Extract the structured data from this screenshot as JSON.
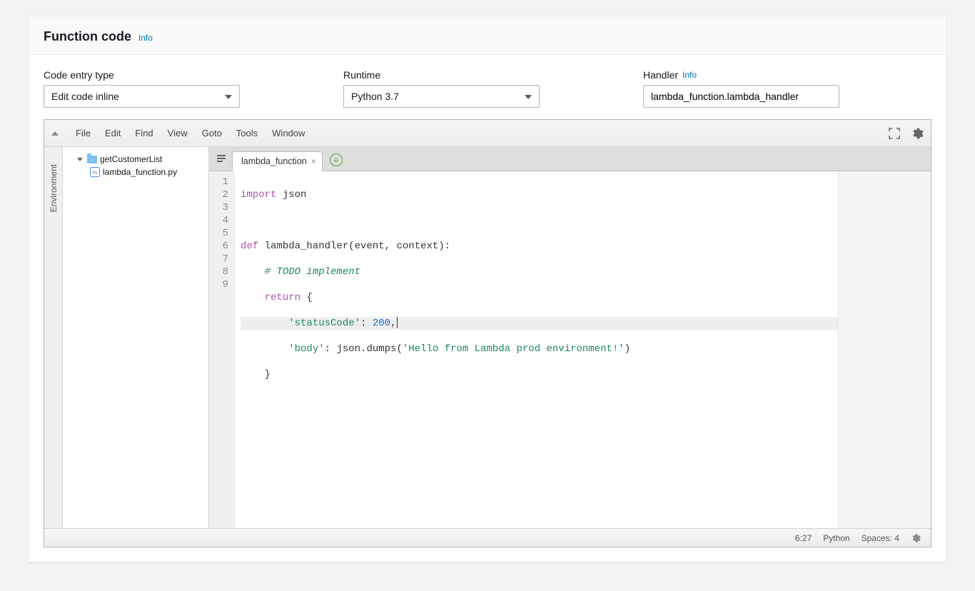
{
  "panel": {
    "title": "Function code",
    "info_label": "Info"
  },
  "config": {
    "code_entry_type": {
      "label": "Code entry type",
      "value": "Edit code inline"
    },
    "runtime": {
      "label": "Runtime",
      "value": "Python 3.7"
    },
    "handler": {
      "label": "Handler",
      "info_label": "Info",
      "value": "lambda_function.lambda_handler"
    }
  },
  "menubar": {
    "items": [
      "File",
      "Edit",
      "Find",
      "View",
      "Goto",
      "Tools",
      "Window"
    ]
  },
  "sidebar": {
    "environment_label": "Environment",
    "root_folder": "getCustomerList",
    "file": "lambda_function.py"
  },
  "tabs": {
    "active": "lambda_function"
  },
  "code": {
    "line_numbers": [
      "1",
      "2",
      "3",
      "4",
      "5",
      "6",
      "7",
      "8",
      "9"
    ],
    "highlight_line_index": 5,
    "line1_import": "import",
    "line1_json": " json",
    "line3_def": "def",
    "line3_sig": " lambda_handler(event, context):",
    "line4_comment": "# TODO implement",
    "line5_return": "return",
    "line5_brace": " {",
    "line6_key": "'statusCode'",
    "line6_colon": ": ",
    "line6_num": "200",
    "line6_comma": ",",
    "line7_key": "'body'",
    "line7_mid": ": json.dumps(",
    "line7_str": "'Hello from Lambda prod environment!'",
    "line7_close": ")",
    "line8_brace": "    }"
  },
  "statusbar": {
    "cursor_pos": "6:27",
    "language": "Python",
    "spaces": "Spaces: 4"
  }
}
